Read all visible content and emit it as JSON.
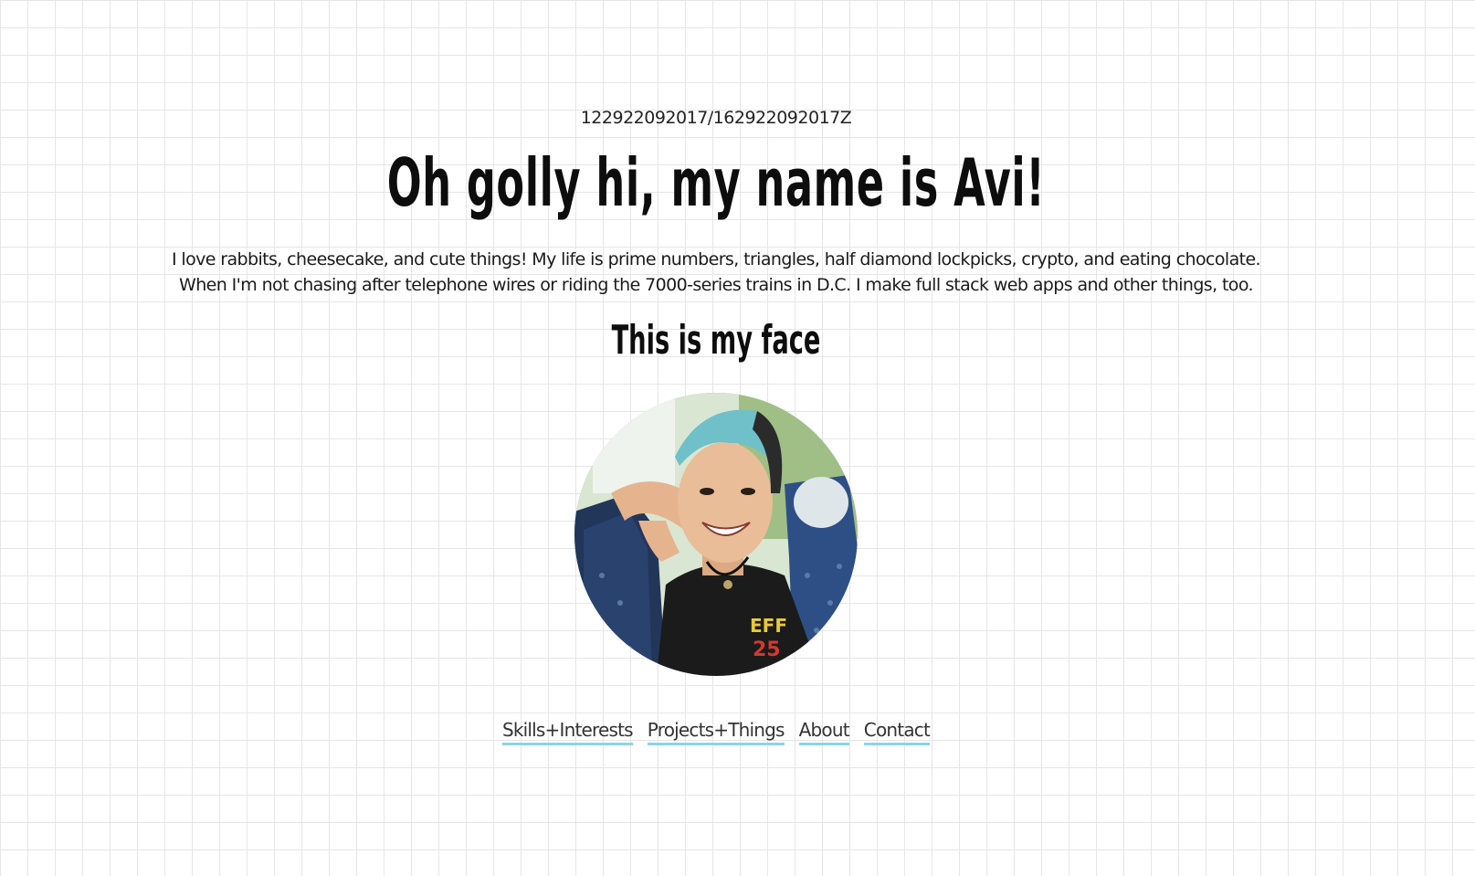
{
  "header": {
    "timestamp": "122922092017/162922092017Z",
    "title": "Oh golly hi, my name is Avi!"
  },
  "bio": {
    "line1": "I love rabbits, cheesecake, and cute things! My life is prime numbers, triangles, half diamond lockpicks, crypto, and eating chocolate.",
    "line2": "When I'm not chasing after telephone wires or riding the 7000-series trains in D.C. I make full stack web apps and other things, too."
  },
  "face_section": {
    "heading": "This is my face"
  },
  "nav": {
    "items": [
      {
        "label": "Skills+Interests"
      },
      {
        "label": "Projects+Things"
      },
      {
        "label": "About"
      },
      {
        "label": "Contact"
      }
    ]
  },
  "colors": {
    "link_underline": "#8fd3e4",
    "grid_line": "#e6e6e6",
    "text": "#0d0d0d"
  }
}
